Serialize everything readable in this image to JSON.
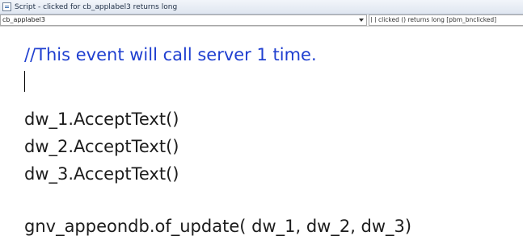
{
  "window": {
    "title": "Script - clicked for cb_applabel3 returns long"
  },
  "toolbar": {
    "object_value": "cb_applabel3",
    "event_value": "clicked () returns long [pbm_bnclicked]"
  },
  "editor": {
    "lines": [
      "//This event will call server 1 time.",
      "dw_1.AcceptText()",
      "dw_2.AcceptText()",
      "dw_3.AcceptText()",
      "gnv_appeondb.of_update( dw_1, dw_2, dw_3)"
    ],
    "comment_color": "#1f3fd0",
    "text_color": "#1c1c1c"
  }
}
